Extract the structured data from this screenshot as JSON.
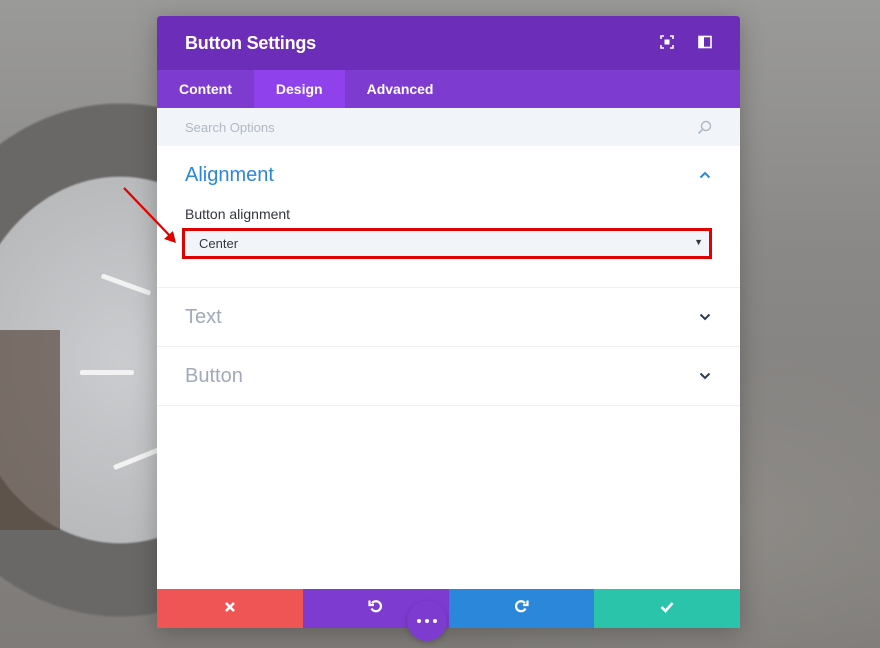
{
  "modal": {
    "title": "Button Settings",
    "tabs": [
      {
        "label": "Content",
        "active": false
      },
      {
        "label": "Design",
        "active": true
      },
      {
        "label": "Advanced",
        "active": false
      }
    ],
    "search": {
      "placeholder": "Search Options"
    }
  },
  "sections": {
    "alignment": {
      "title": "Alignment",
      "expanded": true,
      "field_label": "Button alignment",
      "select_value": "Center"
    },
    "text": {
      "title": "Text",
      "expanded": false
    },
    "button": {
      "title": "Button",
      "expanded": false
    }
  },
  "footer": {
    "buttons": [
      "close-icon",
      "undo-icon",
      "redo-icon",
      "check-icon"
    ]
  },
  "colors": {
    "header": "#6c2eb9",
    "tabs": "#7e3bd0",
    "active_tab": "#8f42ec",
    "section_open": "#2b87da",
    "cancel": "#ef5555",
    "undo": "#7e3bd0",
    "redo": "#2b87da",
    "save": "#29c4a9",
    "annotation": "#e00000"
  }
}
